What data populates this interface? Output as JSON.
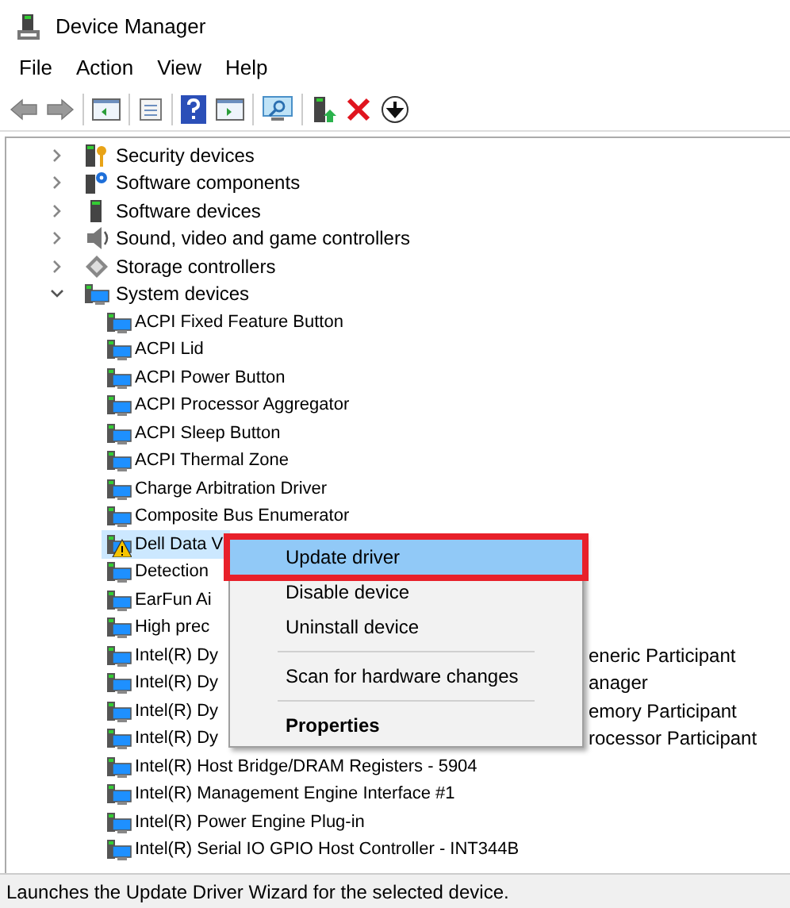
{
  "window": {
    "title": "Device Manager"
  },
  "menu_bar": [
    "File",
    "Action",
    "View",
    "Help"
  ],
  "tree": [
    {
      "label": "Security devices",
      "kind": "security",
      "expanded": false
    },
    {
      "label": "Software components",
      "kind": "component",
      "expanded": false
    },
    {
      "label": "Software devices",
      "kind": "software",
      "expanded": false
    },
    {
      "label": "Sound, video and game controllers",
      "kind": "sound",
      "expanded": false
    },
    {
      "label": "Storage controllers",
      "kind": "storage",
      "expanded": false
    },
    {
      "label": "System devices",
      "kind": "system",
      "expanded": true,
      "children": [
        {
          "label": "ACPI Fixed Feature Button",
          "selected": false,
          "warning": false
        },
        {
          "label": "ACPI Lid",
          "selected": false,
          "warning": false
        },
        {
          "label": "ACPI Power Button",
          "selected": false,
          "warning": false
        },
        {
          "label": "ACPI Processor Aggregator",
          "selected": false,
          "warning": false
        },
        {
          "label": "ACPI Sleep Button",
          "selected": false,
          "warning": false
        },
        {
          "label": "ACPI Thermal Zone",
          "selected": false,
          "warning": false
        },
        {
          "label": "Charge Arbitration Driver",
          "selected": false,
          "warning": false
        },
        {
          "label": "Composite Bus Enumerator",
          "selected": false,
          "warning": false
        },
        {
          "label": "Dell Data V",
          "selected": true,
          "warning": true
        },
        {
          "label": "Detection",
          "selected": false,
          "warning": false
        },
        {
          "label": "EarFun Ai",
          "selected": false,
          "warning": false
        },
        {
          "label": "High prec",
          "selected": false,
          "warning": false
        },
        {
          "label": "Intel(R) Dy",
          "label_after_menu": "eneric Participant",
          "selected": false,
          "warning": false
        },
        {
          "label": "Intel(R) Dy",
          "label_after_menu": "anager",
          "selected": false,
          "warning": false
        },
        {
          "label": "Intel(R) Dy",
          "label_after_menu": "emory Participant",
          "selected": false,
          "warning": false
        },
        {
          "label": "Intel(R) Dy",
          "label_after_menu": "rocessor Participant",
          "selected": false,
          "warning": false
        },
        {
          "label": "Intel(R) Host Bridge/DRAM Registers - 5904",
          "selected": false,
          "warning": false
        },
        {
          "label": "Intel(R) Management Engine Interface #1",
          "selected": false,
          "warning": false
        },
        {
          "label": "Intel(R) Power Engine Plug-in",
          "selected": false,
          "warning": false
        },
        {
          "label": "Intel(R) Serial IO GPIO Host Controller - INT344B",
          "selected": false,
          "warning": false
        }
      ]
    }
  ],
  "context_menu": {
    "items": [
      {
        "kind": "item",
        "label": "Update driver",
        "selected": true,
        "highlighted": true,
        "bold": false
      },
      {
        "kind": "item",
        "label": "Disable device",
        "selected": false,
        "highlighted": false,
        "bold": false
      },
      {
        "kind": "item",
        "label": "Uninstall device",
        "selected": false,
        "highlighted": false,
        "bold": false
      },
      {
        "kind": "separator"
      },
      {
        "kind": "item",
        "label": "Scan for hardware changes",
        "selected": false,
        "highlighted": false,
        "bold": false
      },
      {
        "kind": "separator"
      },
      {
        "kind": "item",
        "label": "Properties",
        "selected": false,
        "highlighted": false,
        "bold": true
      }
    ]
  },
  "status_bar": {
    "text": "Launches the Update Driver Wizard for the selected device."
  }
}
